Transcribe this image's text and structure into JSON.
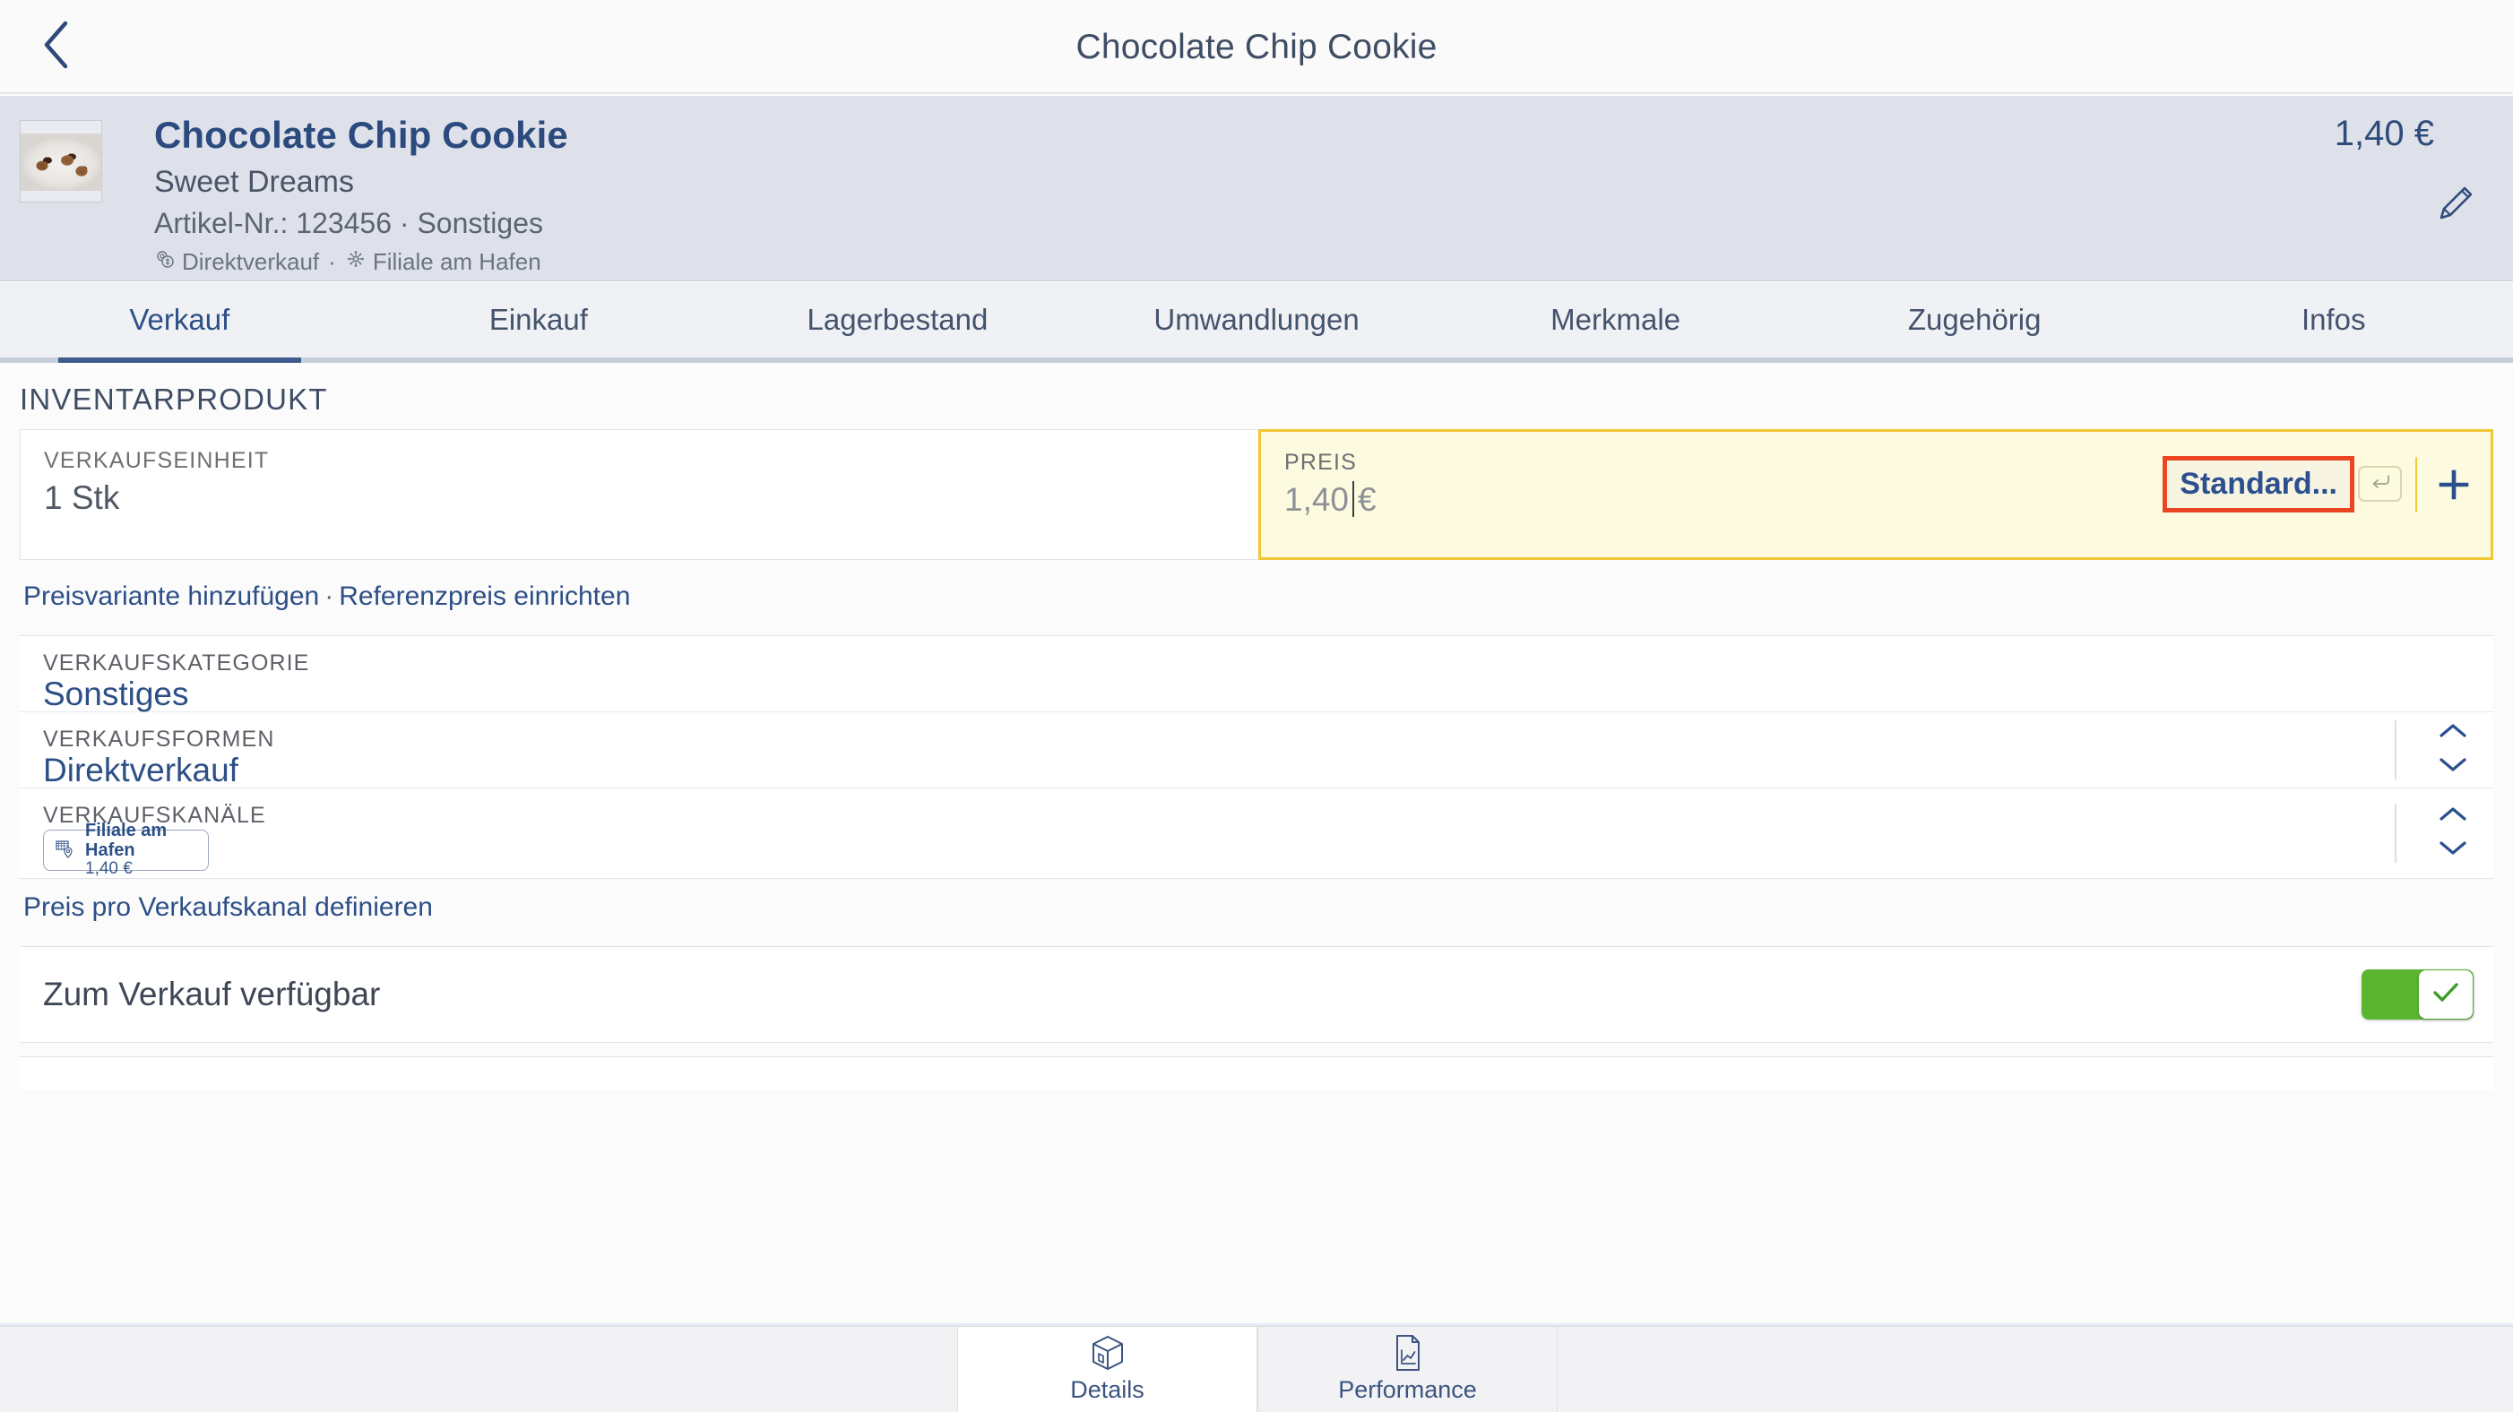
{
  "topbar": {
    "back_icon": "chevron-left-icon",
    "title": "Chocolate Chip Cookie"
  },
  "product_header": {
    "thumbnail_alt": "chocolate-chip-cookie-photo",
    "name": "Chocolate Chip Cookie",
    "vendor": "Sweet Dreams",
    "meta": "Artikel-Nr.: 123456 · Sonstiges",
    "channel_sales_form": "Direktverkauf",
    "channel_separator": "·",
    "channel_branch": "Filiale am Hafen",
    "price": "1,40 €",
    "edit_icon": "pencil-icon"
  },
  "tabs": [
    {
      "label": "Verkauf",
      "active": true
    },
    {
      "label": "Einkauf",
      "active": false
    },
    {
      "label": "Lagerbestand",
      "active": false
    },
    {
      "label": "Umwandlungen",
      "active": false
    },
    {
      "label": "Merkmale",
      "active": false
    },
    {
      "label": "Zugehörig",
      "active": false
    },
    {
      "label": "Infos",
      "active": false
    }
  ],
  "main": {
    "section_title": "INVENTARPRODUKT",
    "unit": {
      "label": "VERKAUFSEINHEIT",
      "value": "1 Stk"
    },
    "price_field": {
      "label": "PREIS",
      "value": "1,40",
      "currency": "€",
      "standard_button": "Standard...",
      "enter_icon": "enter-return-icon",
      "add_icon": "plus-icon",
      "highlight_border_color": "#ec4524",
      "field_border_color": "#f0c735",
      "field_background_color": "#fdfbdf"
    },
    "price_links": {
      "add_variant": "Preisvariante hinzufügen",
      "separator": "·",
      "reference_price": "Referenzpreis einrichten"
    },
    "sales_category": {
      "label": "VERKAUFSKATEGORIE",
      "value": "Sonstiges"
    },
    "sales_forms": {
      "label": "VERKAUFSFORMEN",
      "value": "Direktverkauf",
      "stepper_up_icon": "chevron-up-icon",
      "stepper_down_icon": "chevron-down-icon"
    },
    "sales_channels": {
      "label": "VERKAUFSKANÄLE",
      "chip_icon": "store-pin-icon",
      "chip_name": "Filiale am Hafen",
      "chip_price": "1,40 €",
      "stepper_up_icon": "chevron-up-icon",
      "stepper_down_icon": "chevron-down-icon"
    },
    "channel_price_link": "Preis pro Verkaufskanal definieren",
    "availability": {
      "label": "Zum Verkauf verfügbar",
      "toggle_on": true,
      "toggle_color": "#5cb531",
      "check_icon": "check-icon"
    }
  },
  "bottom_nav": [
    {
      "label": "Details",
      "icon": "box-3d-icon",
      "active": true
    },
    {
      "label": "Performance",
      "icon": "document-chart-icon",
      "active": false
    }
  ],
  "colors": {
    "accent_blue": "#2d4f86",
    "header_panel": "#dee1e9",
    "tab_underline": "#3d5c8c",
    "highlight_red": "#ec4524",
    "highlight_yellow": "#f0c735"
  }
}
